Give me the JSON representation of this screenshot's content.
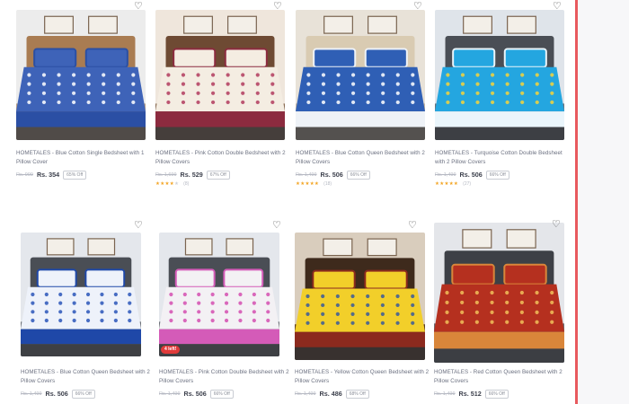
{
  "products": [
    {
      "title": "HOMETALES - Blue Cotton Single Bedsheet with 1 Pillow Cover",
      "mrp": "Rs. 999",
      "price": "Rs. 354",
      "discount": "65% Off",
      "rating_stars": 0,
      "rating_count": "",
      "badge": "",
      "colors": {
        "wall": "#ececec",
        "floor": "#b89f86",
        "sheet": "#3e63b8",
        "pattern": "#ffffff",
        "border": "#2b4fa4",
        "headboard": "#a97c52"
      }
    },
    {
      "title": "HOMETALES - Pink Cotton Double Bedsheet with 2 Pillow Covers",
      "mrp": "Rs. 1,699",
      "price": "Rs. 529",
      "discount": "67% Off",
      "rating_stars": 4,
      "rating_count": "(8)",
      "badge": "",
      "colors": {
        "wall": "#efe6dc",
        "floor": "#8a6d55",
        "sheet": "#f4ede2",
        "pattern": "#b23b5e",
        "border": "#8c2b3f",
        "headboard": "#6e4a33"
      }
    },
    {
      "title": "HOMETALES - Blue Cotton Queen Bedsheet with 2 Pillow Covers",
      "mrp": "Rs. 1,499",
      "price": "Rs. 506",
      "discount": "66% Off",
      "rating_stars": 5,
      "rating_count": "(18)",
      "badge": "",
      "colors": {
        "wall": "#e8e2d8",
        "floor": "#c7b8a3",
        "sheet": "#2f5fb5",
        "pattern": "#ffffff",
        "border": "#eef2f7",
        "headboard": "#d9cbb2"
      }
    },
    {
      "title": "HOMETALES - Turquoise Cotton Double Bedsheet with 2 Pillow Covers",
      "mrp": "Rs. 1,499",
      "price": "Rs. 506",
      "discount": "66% Off",
      "rating_stars": 5,
      "rating_count": "(27)",
      "badge": "",
      "colors": {
        "wall": "#dfe4ea",
        "floor": "#6d7178",
        "sheet": "#24a6e0",
        "pattern": "#f6d33a",
        "border": "#eaf5fb",
        "headboard": "#4a4e55"
      }
    },
    {
      "title": "HOMETALES - Blue Cotton Queen Bedsheet with 2 Pillow Covers",
      "mrp": "Rs. 1,499",
      "price": "Rs. 506",
      "discount": "66% Off",
      "rating_stars": 0,
      "rating_count": "",
      "badge": "",
      "colors": {
        "wall": "#e4e7ec",
        "floor": "#6f737a",
        "sheet": "#eef2fa",
        "pattern": "#2a56b8",
        "border": "#1f48a8",
        "headboard": "#4a4e55"
      }
    },
    {
      "title": "HOMETALES - Pink Cotton Double Bedsheet with 2 Pillow Covers",
      "mrp": "Rs. 1,499",
      "price": "Rs. 506",
      "discount": "66% Off",
      "rating_stars": 0,
      "rating_count": "",
      "badge": "4 left!",
      "colors": {
        "wall": "#e4e7ec",
        "floor": "#6f737a",
        "sheet": "#f3f1f4",
        "pattern": "#d44fb0",
        "border": "#d45bb8",
        "headboard": "#4a4e55"
      }
    },
    {
      "title": "HOMETALES - Yellow Cotton Queen Bedsheet with 2 Pillow Covers",
      "mrp": "Rs. 1,499",
      "price": "Rs. 486",
      "discount": "68% Off",
      "rating_stars": 0,
      "rating_count": "",
      "badge": "",
      "colors": {
        "wall": "#d9cdbd",
        "floor": "#5a3a26",
        "sheet": "#f2cf2a",
        "pattern": "#3a5a9a",
        "border": "#8c2a1e",
        "headboard": "#3e2a1c"
      }
    },
    {
      "title": "HOMETALES - Red Cotton Queen Bedsheet with 2 Pillow Covers",
      "mrp": "Rs. 1,499",
      "price": "Rs. 512",
      "discount": "66% Off",
      "rating_stars": 0,
      "rating_count": "",
      "badge": "",
      "colors": {
        "wall": "#e4e6ea",
        "floor": "#6a6e75",
        "sheet": "#b5301f",
        "pattern": "#f1c05a",
        "border": "#d9863a",
        "headboard": "#3d4046"
      }
    }
  ]
}
